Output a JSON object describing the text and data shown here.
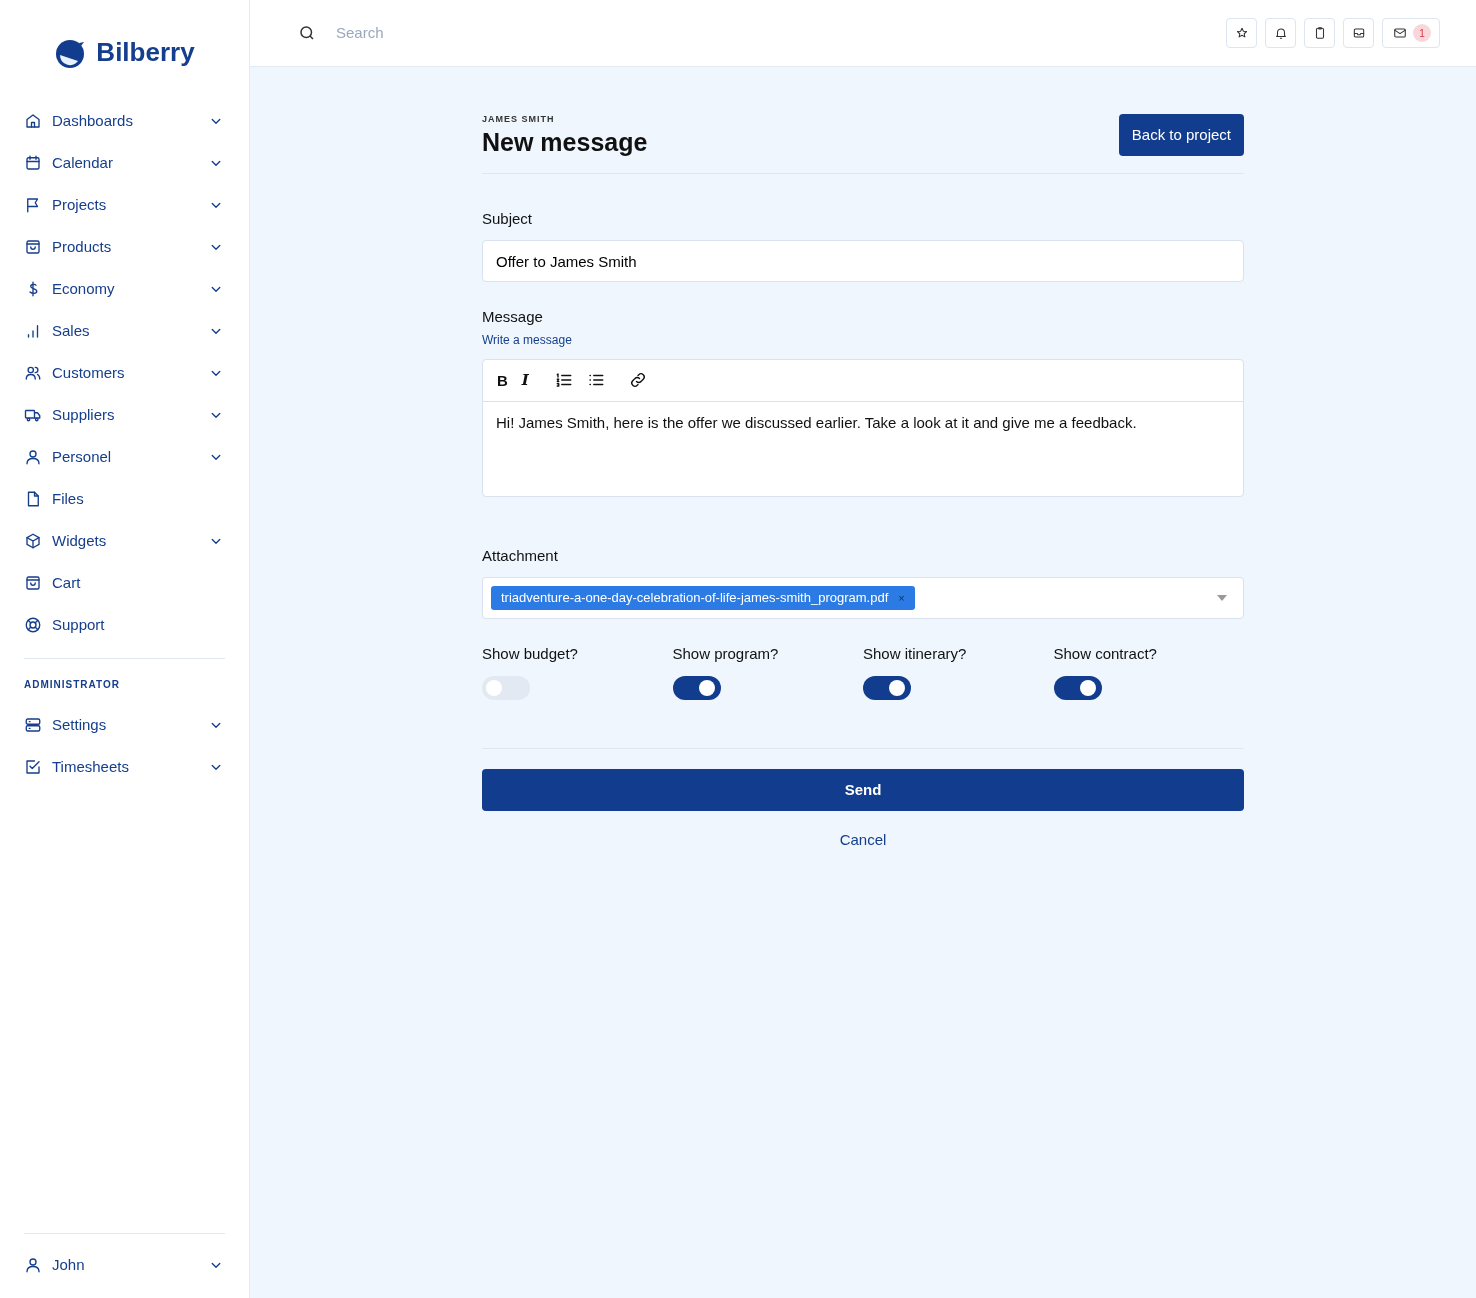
{
  "brand": {
    "name": "Bilberry"
  },
  "sidebar": {
    "items": [
      {
        "label": "Dashboards",
        "expandable": true
      },
      {
        "label": "Calendar",
        "expandable": true
      },
      {
        "label": "Projects",
        "expandable": true
      },
      {
        "label": "Products",
        "expandable": true
      },
      {
        "label": "Economy",
        "expandable": true
      },
      {
        "label": "Sales",
        "expandable": true
      },
      {
        "label": "Customers",
        "expandable": true
      },
      {
        "label": "Suppliers",
        "expandable": true
      },
      {
        "label": "Personel",
        "expandable": true
      },
      {
        "label": "Files",
        "expandable": false
      },
      {
        "label": "Widgets",
        "expandable": true
      },
      {
        "label": "Cart",
        "expandable": false
      },
      {
        "label": "Support",
        "expandable": false
      }
    ],
    "section_title": "ADMINISTRATOR",
    "admin_items": [
      {
        "label": "Settings",
        "expandable": true
      },
      {
        "label": "Timesheets",
        "expandable": true
      }
    ],
    "user": {
      "label": "John",
      "expandable": true
    }
  },
  "topbar": {
    "search": {
      "placeholder": "Search"
    },
    "mail_badge": "1"
  },
  "header": {
    "eyebrow": "JAMES SMITH",
    "title": "New message",
    "back_button": "Back to project"
  },
  "form": {
    "subject": {
      "label": "Subject",
      "value": "Offer to James Smith"
    },
    "message": {
      "label": "Message",
      "hint": "Write a message",
      "toolbar": [
        "B",
        "I"
      ],
      "value": "Hi! James Smith, here is the offer we discussed earlier. Take a look at it and give me a feedback."
    },
    "attachment": {
      "label": "Attachment",
      "tags": [
        {
          "text": "triadventure-a-one-day-celebration-of-life-james-smith_program.pdf",
          "remove": "×"
        }
      ]
    },
    "toggles": [
      {
        "label": "Show budget?",
        "on": false
      },
      {
        "label": "Show program?",
        "on": true
      },
      {
        "label": "Show itinerary?",
        "on": true
      },
      {
        "label": "Show contract?",
        "on": true
      }
    ],
    "send_button": "Send",
    "cancel_link": "Cancel"
  }
}
